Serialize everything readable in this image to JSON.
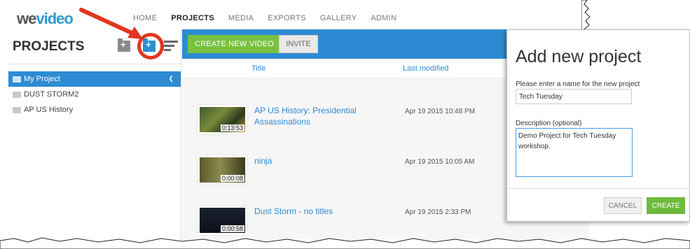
{
  "header": {
    "logo_we": "we",
    "logo_video": "video",
    "nav": [
      {
        "label": "HOME",
        "active": false
      },
      {
        "label": "PROJECTS",
        "active": true
      },
      {
        "label": "MEDIA",
        "active": false
      },
      {
        "label": "EXPORTS",
        "active": false
      },
      {
        "label": "GALLERY",
        "active": false
      },
      {
        "label": "ADMIN",
        "active": false
      }
    ]
  },
  "sidebar": {
    "title": "PROJECTS",
    "projects": [
      {
        "label": "My Project",
        "active": true
      },
      {
        "label": "DUST STORM2",
        "active": false
      },
      {
        "label": "AP US History",
        "active": false
      }
    ]
  },
  "toolbar": {
    "create_label": "CREATE NEW VIDEO",
    "invite_label": "INVITE"
  },
  "columns": {
    "title": "Title",
    "last_modified": "Last modified"
  },
  "videos": [
    {
      "title": "AP US History: Presidential Assassinations",
      "date": "Apr 19 2015 10:48 PM",
      "duration": "0:13:53"
    },
    {
      "title": "ninja",
      "date": "Apr 19 2015 10:05 AM",
      "duration": "0:00:08"
    },
    {
      "title": "Dust Storm - no titles",
      "date": "Apr 19 2015 2:33 PM",
      "duration": "0:00:58"
    }
  ],
  "dialog": {
    "title": "Add new project",
    "name_label": "Please enter a name for the new project",
    "name_value": "Tech Tuesday",
    "desc_label": "Description (optional)",
    "desc_value": "Demo Project for Tech Tuesday workshop.",
    "cancel_label": "CANCEL",
    "create_label": "CREATE"
  },
  "colors": {
    "accent_blue": "#2e8bd3",
    "green": "#79c141",
    "highlight_red": "#e2351f"
  }
}
